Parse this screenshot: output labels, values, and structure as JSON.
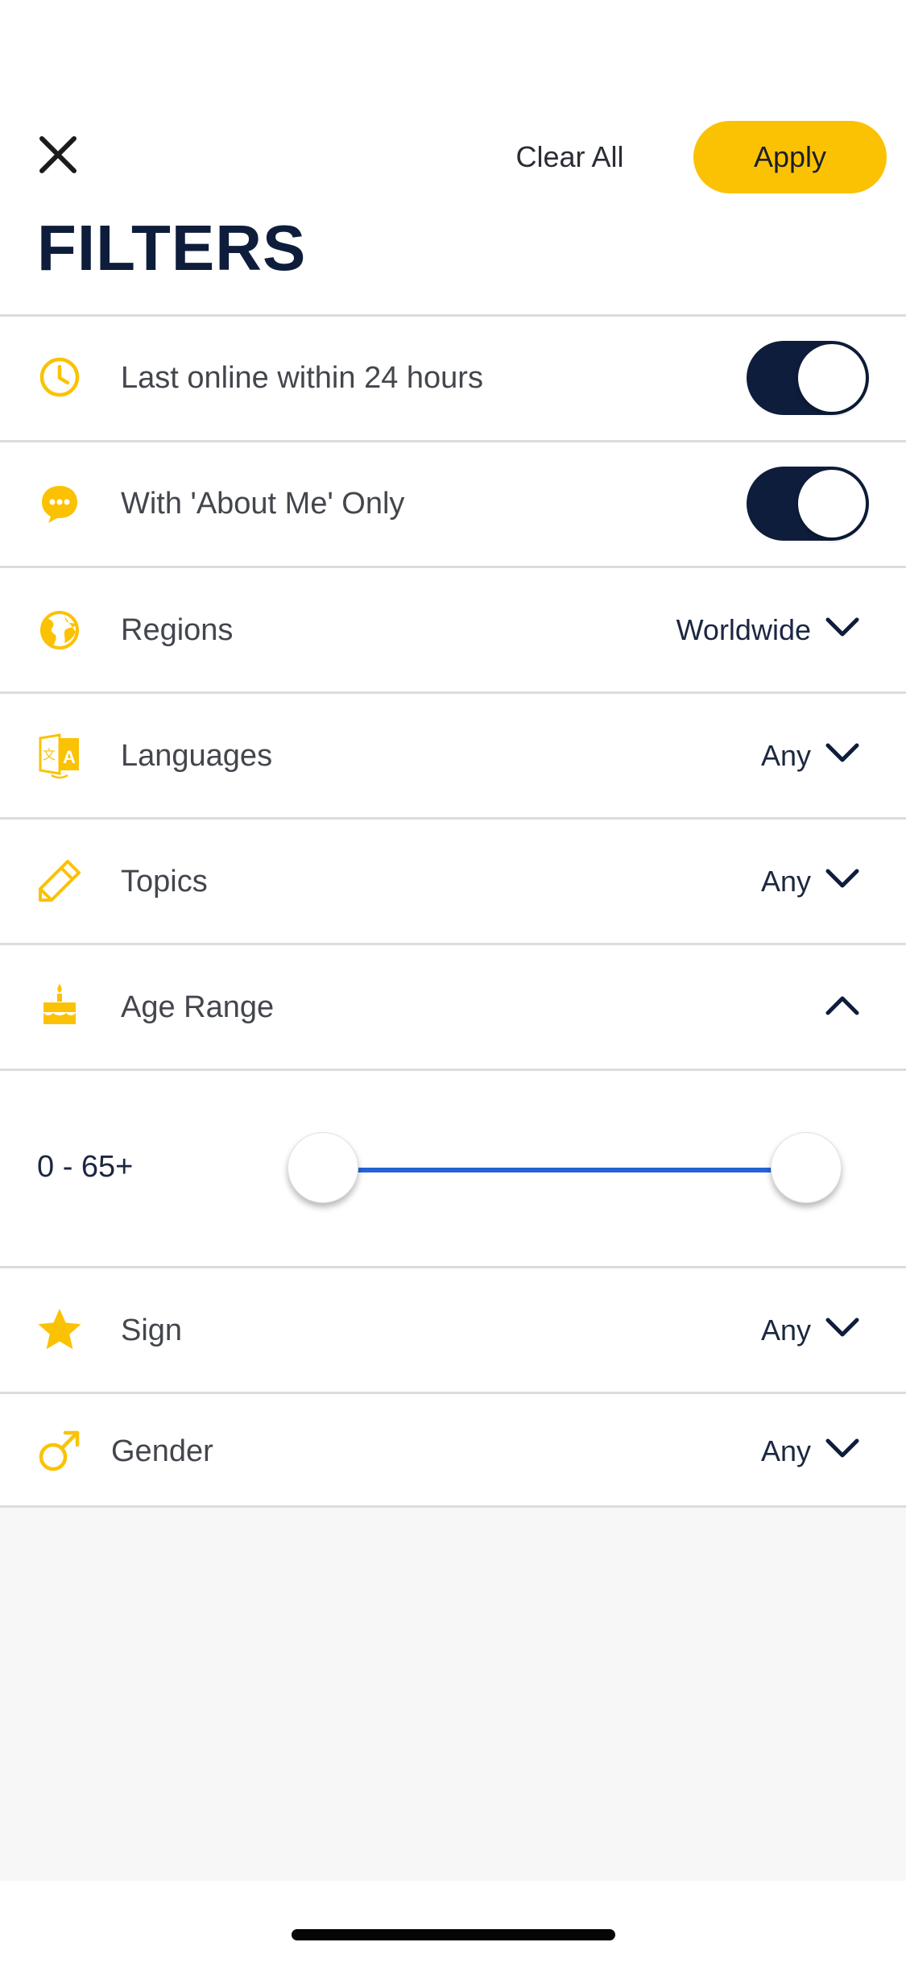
{
  "header": {
    "close_icon": "close-icon",
    "clear_all_label": "Clear All",
    "apply_label": "Apply",
    "apply_color": "#fbc204",
    "title": "FILTERS",
    "title_color": "#0e1d3b"
  },
  "filters": {
    "last_online": {
      "label": "Last online within 24 hours",
      "icon": "clock-icon",
      "toggle_on": true
    },
    "about_me": {
      "label": "With 'About Me' Only",
      "icon": "chat-bubble-icon",
      "toggle_on": true
    },
    "regions": {
      "label": "Regions",
      "value": "Worldwide",
      "icon": "globe-icon"
    },
    "languages": {
      "label": "Languages",
      "value": "Any",
      "icon": "translate-icon"
    },
    "topics": {
      "label": "Topics",
      "value": "Any",
      "icon": "pencil-icon"
    },
    "age_range": {
      "label": "Age Range",
      "icon": "cake-icon",
      "expanded": true,
      "range_text": "0 - 65+",
      "min_fraction": 0.0,
      "max_fraction": 1.0
    },
    "sign": {
      "label": "Sign",
      "value": "Any",
      "icon": "star-icon"
    },
    "gender": {
      "label": "Gender",
      "value": "Any",
      "icon": "male-symbol-icon"
    }
  },
  "colors": {
    "accent_yellow": "#fbc204",
    "navy": "#0e1d3b",
    "slider_blue": "#2563d6"
  }
}
